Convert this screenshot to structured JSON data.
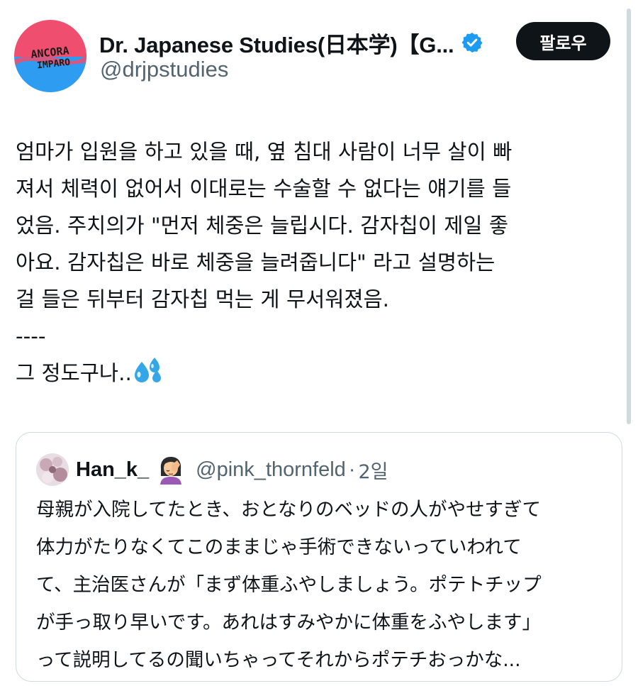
{
  "author": {
    "display_name": "Dr. Japanese Studies(日本学)【G...",
    "handle": "@drjpstudies",
    "verified": true,
    "avatar_text_top": "ANCORA",
    "avatar_text_bottom": "IMPARO",
    "avatar_colors": {
      "top": "#f04e6e",
      "bottom": "#2e9cf0"
    }
  },
  "follow_button": {
    "label": "팔로우"
  },
  "tweet": {
    "lines": [
      "엄마가 입원을 하고 있을 때, 옆 침대 사람이 너무 살이 빠",
      "져서 체력이 없어서 이대로는 수술할 수 없다는 얘기를 들",
      "었음. 주치의가 \"먼저 체중은 늘립시다. 감자칩이 제일 좋",
      "아요. 감자칩은 바로 체중을 늘려줍니다\" 라고 설명하는",
      "걸 들은 뒤부터 감자칩 먹는 게 무서워졌음.",
      "----",
      "그 정도구나.."
    ],
    "trailing_emoji": "sweat-droplets-icon"
  },
  "quoted_tweet": {
    "display_name": "Han_k_",
    "name_emoji": "facepalm-woman-icon",
    "handle": "@pink_thornfeld",
    "separator": "·",
    "timestamp": "2일",
    "lines": [
      "母親が入院してたとき、おとなりのベッドの人がやせすぎて",
      "体力がたりなくてこのままじゃ手術できないっていわれて",
      "て、主治医さんが「まず体重ふやしましょう。ポテトチップ",
      "が手っ取り早いです。あれはすみやかに体重をふやします」",
      "って説明してるの聞いちゃってそれからポテチおっかな..."
    ]
  },
  "colors": {
    "text_primary": "#0f1419",
    "text_secondary": "#536471",
    "verified_blue": "#1d9bf0",
    "border": "#cfd9de",
    "follow_bg": "#0f1419"
  }
}
